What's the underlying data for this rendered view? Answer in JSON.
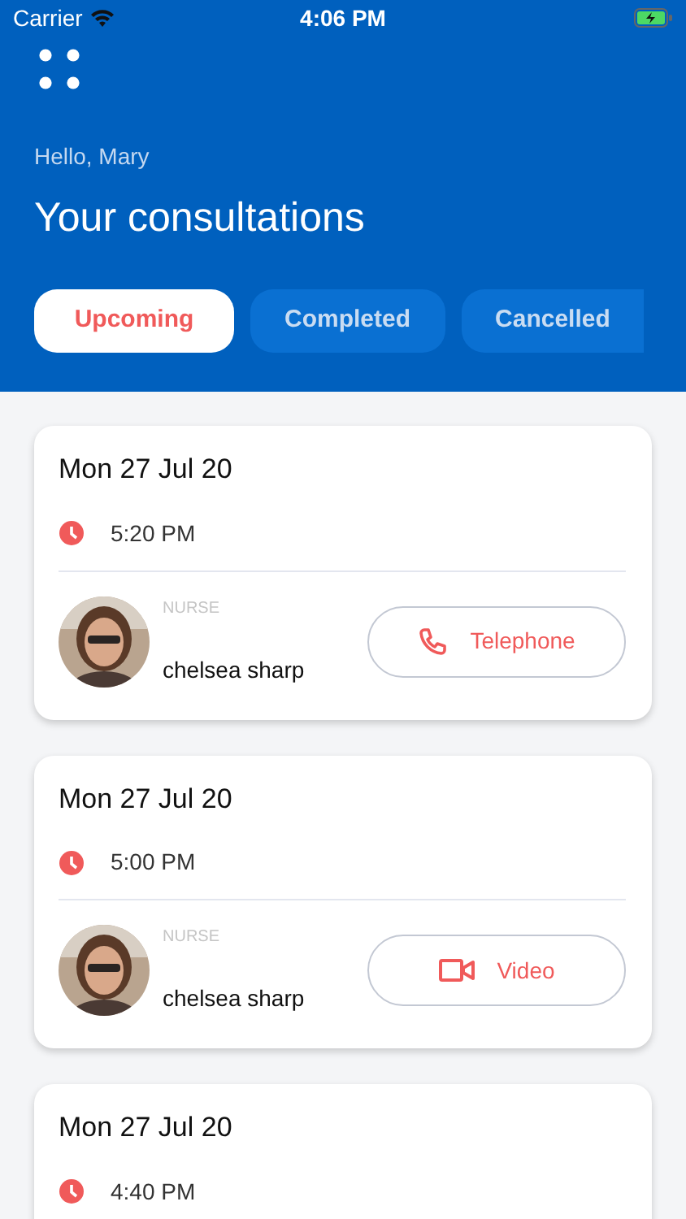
{
  "status_bar": {
    "carrier": "Carrier",
    "time": "4:06 PM"
  },
  "greeting": "Hello, Mary",
  "title": "Your consultations",
  "tabs": [
    {
      "label": "Upcoming",
      "selected": true
    },
    {
      "label": "Completed",
      "selected": false
    },
    {
      "label": "Cancelled",
      "selected": false
    }
  ],
  "consultations": [
    {
      "date": "Mon 27 Jul 20",
      "time": "5:20 PM",
      "person": {
        "role": "NURSE",
        "name": "chelsea sharp"
      },
      "call": {
        "kind": "telephone",
        "label": "Telephone"
      }
    },
    {
      "date": "Mon 27 Jul 20",
      "time": "5:00 PM",
      "person": {
        "role": "NURSE",
        "name": "chelsea sharp"
      },
      "call": {
        "kind": "video",
        "label": "Video"
      }
    },
    {
      "date": "Mon 27 Jul 20",
      "time": "4:40 PM"
    }
  ]
}
